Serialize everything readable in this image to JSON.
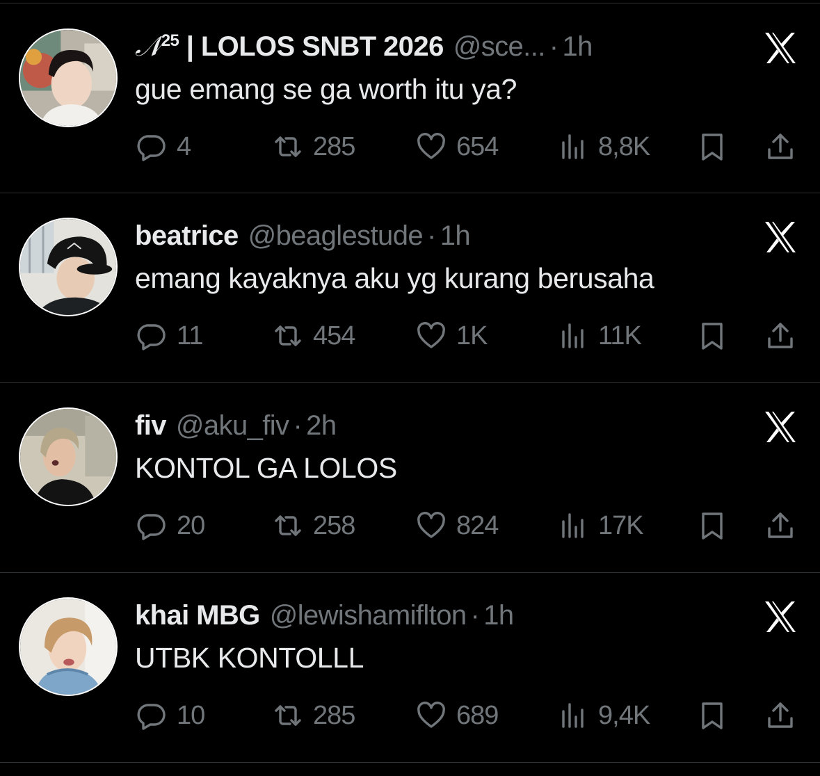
{
  "tweets": [
    {
      "name_prefix": "𝒩",
      "name_sup": "25",
      "name_rest": " | LOLOS SNBT 2026",
      "handle": "@sce...",
      "time": "1h",
      "text": "gue emang se ga worth itu ya?",
      "replies": "4",
      "retweets": "285",
      "likes": "654",
      "views": "8,8K"
    },
    {
      "name_prefix": "",
      "name_sup": "",
      "name_rest": "beatrice",
      "handle": "@beaglestude",
      "time": "1h",
      "text": "emang kayaknya aku yg kurang berusaha",
      "replies": "11",
      "retweets": "454",
      "likes": "1K",
      "views": "11K"
    },
    {
      "name_prefix": "",
      "name_sup": "",
      "name_rest": "fiv",
      "handle": "@aku_fiv",
      "time": "2h",
      "text": "KONTOL GA LOLOS",
      "replies": "20",
      "retweets": "258",
      "likes": "824",
      "views": "17K"
    },
    {
      "name_prefix": "",
      "name_sup": "",
      "name_rest": "khai MBG",
      "handle": "@lewishamiflton",
      "time": "1h",
      "text": "UTBK KONTOLLL",
      "replies": "10",
      "retweets": "285",
      "likes": "689",
      "views": "9,4K"
    }
  ],
  "separator": "·",
  "icons": {
    "reply": "reply-bubble-icon",
    "retweet": "retweet-icon",
    "like": "heart-icon",
    "views": "views-bars-icon",
    "bookmark": "bookmark-icon",
    "share": "share-icon",
    "brand": "x-logo-icon"
  },
  "colors": {
    "background": "#000000",
    "text": "#e7e9ea",
    "secondary": "#71767b",
    "divider": "#2f3336"
  }
}
